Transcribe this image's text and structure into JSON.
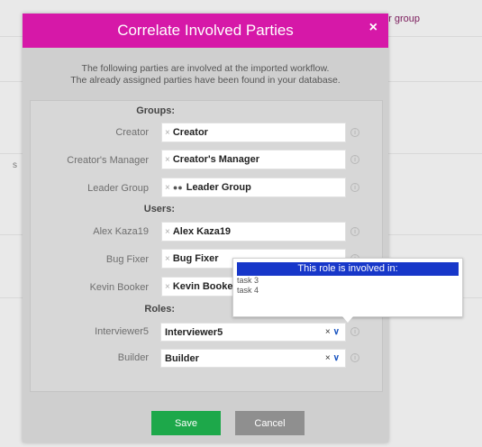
{
  "background": {
    "snippet": "er group",
    "side_mark": "s"
  },
  "dialog": {
    "title": "Correlate Involved Parties",
    "close_glyph": "×",
    "intro": [
      "The following parties are involved at the imported workflow.",
      "The already assigned parties have been found in your database."
    ],
    "sections": {
      "groups": "Groups:",
      "users": "Users:",
      "roles": "Roles:"
    },
    "rows": [
      {
        "label": "Creator",
        "value": "Creator"
      },
      {
        "label": "Creator's Manager",
        "value": "Creator's Manager"
      },
      {
        "label": "Leader Group",
        "value": "Leader Group",
        "icon": "group-icon"
      },
      {
        "label": "Alex Kaza19",
        "value": "Alex Kaza19"
      },
      {
        "label": "Bug Fixer",
        "value": "Bug Fixer"
      },
      {
        "label": "Kevin Booker",
        "value": "Kevin Booker"
      }
    ],
    "roles": [
      {
        "label": "Interviewer5",
        "value": "Interviewer5"
      },
      {
        "label": "Builder",
        "value": "Builder"
      }
    ],
    "tooltip": {
      "title": "This role is involved in:",
      "items": [
        "task 3",
        "task 4"
      ]
    },
    "buttons": {
      "save": "Save",
      "cancel": "Cancel"
    }
  },
  "colors": {
    "title_bar": "#d618a8",
    "save": "#1da84a",
    "cancel": "#8f8f8f",
    "tooltip_header": "#1737c9"
  }
}
